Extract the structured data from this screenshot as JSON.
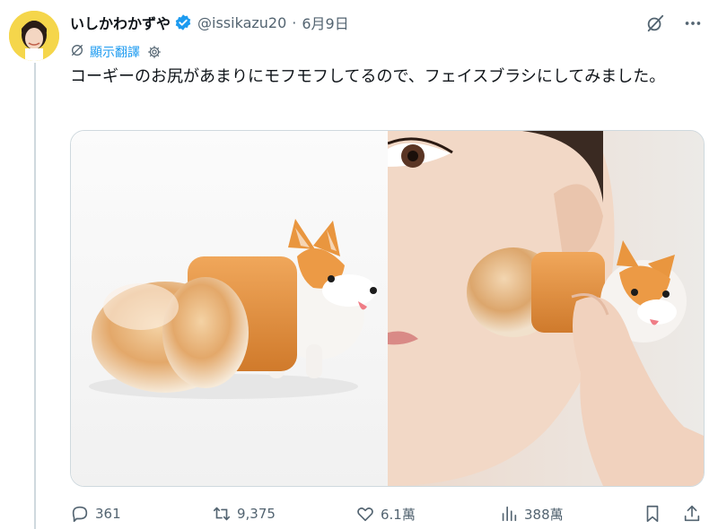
{
  "author": {
    "display_name": "いしかわかずや",
    "handle": "@issikazu20",
    "separator": "·",
    "date": "6月9日"
  },
  "translate": {
    "label": "顯示翻譯"
  },
  "tweet": {
    "text": "コーギーのお尻があまりにモフモフしてるので、フェイスブラシにしてみました。"
  },
  "actions": {
    "replies": "361",
    "retweets": "9,375",
    "likes": "6.1萬",
    "views": "388萬"
  },
  "colors": {
    "accent": "#1d9bf0",
    "muted": "#536471",
    "text": "#0f1419",
    "border": "#cfd9de"
  },
  "icons": [
    "verified-badge-icon",
    "grok-icon",
    "more-icon",
    "translate-icon",
    "settings-gear-icon",
    "reply-icon",
    "retweet-icon",
    "like-icon",
    "views-icon",
    "bookmark-icon",
    "share-icon"
  ]
}
